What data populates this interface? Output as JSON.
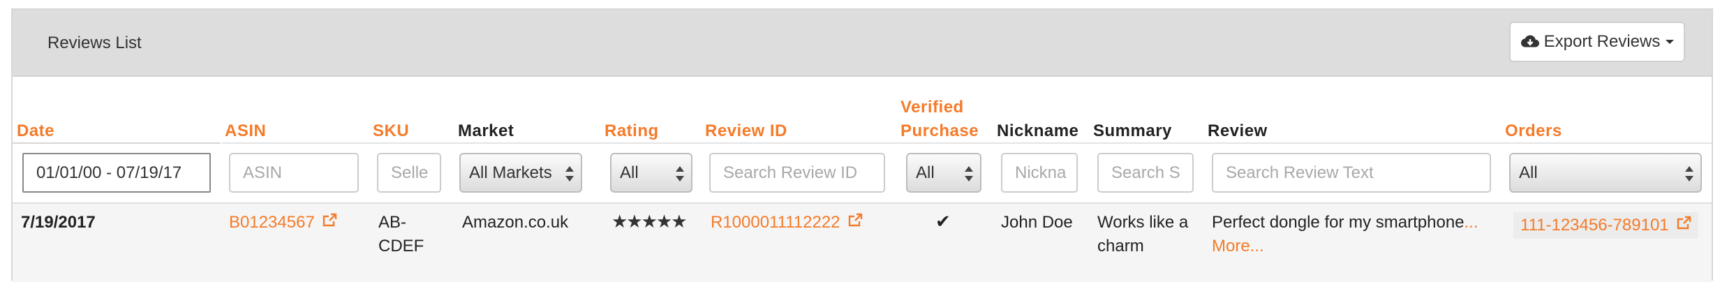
{
  "panel": {
    "title": "Reviews List",
    "export_label": "Export Reviews"
  },
  "columns": {
    "date": "Date",
    "asin": "ASIN",
    "sku": "SKU",
    "market": "Market",
    "rating": "Rating",
    "review_id": "Review ID",
    "verified_line1": "Verified",
    "verified_line2": "Purchase",
    "nickname": "Nickname",
    "summary": "Summary",
    "review": "Review",
    "orders": "Orders"
  },
  "filters": {
    "date_value": "01/01/00 - 07/19/17",
    "asin_placeholder": "ASIN",
    "sku_placeholder": "Selle",
    "market_selected": "All Markets",
    "rating_selected": "All",
    "review_id_placeholder": "Search Review ID",
    "verified_selected": "All",
    "nickname_placeholder": "Nickna",
    "summary_placeholder": "Search S",
    "review_placeholder": "Search Review Text",
    "orders_selected": "All"
  },
  "rows": [
    {
      "date": "7/19/2017",
      "asin": "B01234567",
      "sku_line1": "AB-",
      "sku_line2": "CDEF",
      "market": "Amazon.co.uk",
      "rating": 5,
      "rating_stars": "★★★★★",
      "review_id": "R1000011112222",
      "verified": "✔",
      "nickname": "John Doe",
      "summary_line1": "Works like a",
      "summary_line2": "charm",
      "review_text": "Perfect dongle for my smartphone",
      "review_ellipsis": "...",
      "review_more": "More...",
      "order": "111-123456-789101"
    }
  ],
  "colors": {
    "accent": "#f47b2a",
    "header_bg": "#dddddd",
    "row_bg": "#f5f5f5"
  },
  "icons": {
    "export": "cloud-download-icon",
    "external": "external-link-icon",
    "verified": "check-icon",
    "rating": "star-icon"
  }
}
